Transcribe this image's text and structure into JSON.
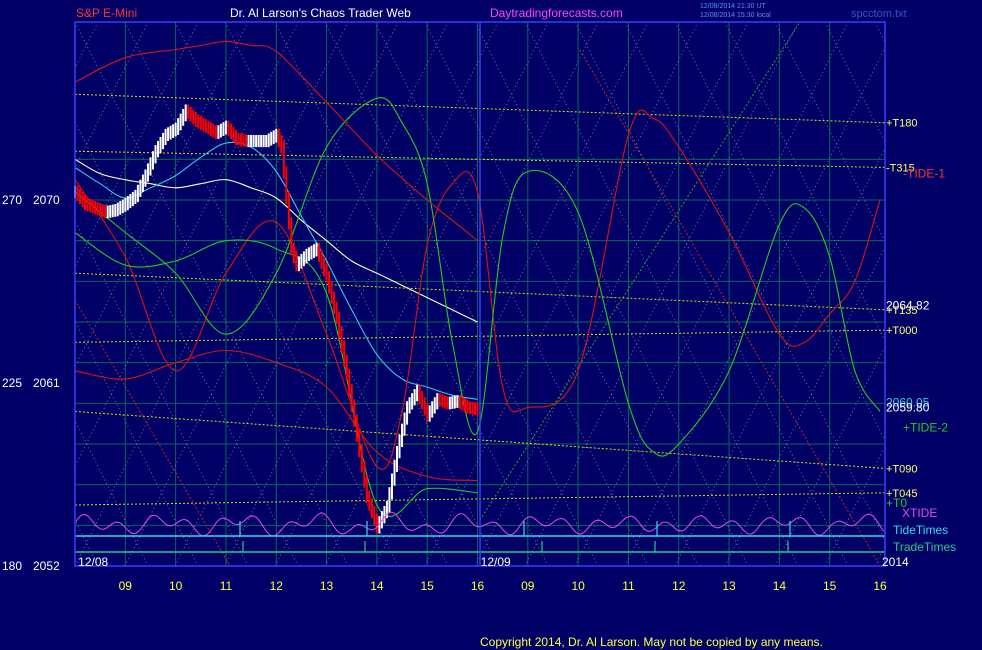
{
  "header": {
    "symbol": "S&P E-Mini",
    "site": "Dr. Al Larson's Chaos Trader Web",
    "url": "Daytradingforecasts.com",
    "stamp1": "12/08/2014 21:30 UT",
    "stamp2": "12/08/2014 15:30 local",
    "file": "spcctom.txt"
  },
  "footer": {
    "copyright": "Copyright 2014, Dr. Al Larson. May not be copied by any means."
  },
  "colors": {
    "background": "#000066",
    "plot_border": "#3a3aff",
    "grid": "#006a5a",
    "price_white": "#ffffff",
    "price_red": "#ff0000",
    "ma_white": "#ffffc8",
    "ma_cyan": "#33ccdd",
    "tide_red": "#dd1111",
    "tide_green": "#22cc22",
    "levels_yellow": "#dddd00",
    "xtide": "#ee44ee",
    "tidetimes": "#33ddee",
    "tradetimes": "#22cc88"
  },
  "chart_data": {
    "type": "line",
    "title": "S&P E-Mini",
    "ylim": [
      2052,
      2074
    ],
    "left_axis_labels": [
      {
        "angle": "270",
        "price": "2070",
        "value": 2070
      },
      {
        "angle": "225",
        "price": "2061",
        "value": 2061
      },
      {
        "angle": "180",
        "price": "2052",
        "value": 2052
      }
    ],
    "x_ticks": [
      {
        "label": "09",
        "t": 1
      },
      {
        "label": "10",
        "t": 2
      },
      {
        "label": "11",
        "t": 3
      },
      {
        "label": "12",
        "t": 4
      },
      {
        "label": "13",
        "t": 5
      },
      {
        "label": "14",
        "t": 6
      },
      {
        "label": "15",
        "t": 7
      },
      {
        "label": "16",
        "t": 8
      },
      {
        "label": "09",
        "t": 9
      },
      {
        "label": "10",
        "t": 10
      },
      {
        "label": "11",
        "t": 11
      },
      {
        "label": "12",
        "t": 12
      },
      {
        "label": "13",
        "t": 13
      },
      {
        "label": "14",
        "t": 14
      },
      {
        "label": "15",
        "t": 15
      },
      {
        "label": "16",
        "t": 16
      }
    ],
    "date_labels": [
      {
        "label": "12/08",
        "t": 0.5
      },
      {
        "label": "12/09",
        "t": 8.5
      },
      {
        "label": "2014",
        "t": 16
      }
    ],
    "day_divider_t": 8,
    "price": {
      "t": [
        0,
        0.2,
        0.4,
        0.6,
        0.8,
        1.0,
        1.2,
        1.4,
        1.6,
        1.8,
        2.0,
        2.2,
        2.4,
        2.6,
        2.8,
        3.0,
        3.2,
        3.4,
        3.6,
        3.8,
        4.0,
        4.1,
        4.2,
        4.3,
        4.4,
        4.6,
        4.8,
        5.0,
        5.2,
        5.4,
        5.6,
        5.8,
        6.0,
        6.2,
        6.4,
        6.6,
        6.8,
        7.0,
        7.2,
        7.4,
        7.6,
        7.8,
        8.0
      ],
      "close": [
        2070.4,
        2069.8,
        2069.6,
        2069.4,
        2069.5,
        2069.8,
        2070.2,
        2071.2,
        2072.4,
        2073.2,
        2073.5,
        2074.4,
        2073.9,
        2073.6,
        2073.3,
        2073.6,
        2073.0,
        2072.9,
        2072.9,
        2072.9,
        2073.2,
        2072.6,
        2070.1,
        2067.6,
        2066.8,
        2067.3,
        2067.6,
        2066.2,
        2064.2,
        2061.4,
        2058.4,
        2055.4,
        2053.9,
        2054.9,
        2057.6,
        2059.8,
        2060.6,
        2059.4,
        2060.2,
        2060.0,
        2060.1,
        2059.8,
        2059.7
      ],
      "upper_band": [
        2073.0,
        2072.6,
        2072.2,
        2071.8,
        2071.6,
        2071.7,
        2072.1,
        2073.0,
        2074.0,
        2074.8,
        2075.2,
        2075.6,
        2075.4,
        2075.2,
        2075.0,
        2075.2,
        2074.8,
        2074.6,
        2074.4,
        2074.3,
        2074.4,
        2073.9,
        2072.9,
        2070.9,
        2069.9,
        2068.8,
        2068.6,
        2067.6,
        2065.8,
        2063.4,
        2060.8,
        2058.2,
        2057.2,
        2058.4,
        2060.6,
        2062.2,
        2062.6,
        2061.8,
        2062.2,
        2062.0,
        2062.2,
        2062.0,
        2061.8
      ],
      "lower_band": [
        2067.8,
        2067.0,
        2066.8,
        2066.8,
        2067.0,
        2067.4,
        2068.2,
        2069.2,
        2070.4,
        2071.4,
        2071.8,
        2072.8,
        2072.4,
        2072.0,
        2071.6,
        2071.8,
        2071.2,
        2071.0,
        2071.0,
        2071.2,
        2071.4,
        2070.8,
        2068.2,
        2065.6,
        2064.4,
        2064.8,
        2064.8,
        2063.6,
        2061.8,
        2059.2,
        2056.2,
        2053.2,
        2052.6,
        2053.4,
        2055.2,
        2057.6,
        2058.4,
        2057.4,
        2058.2,
        2058.0,
        2058.2,
        2057.8,
        2057.6
      ]
    },
    "series": [
      {
        "name": "ma_slow_white",
        "t": [
          0,
          0.5,
          1.0,
          1.5,
          2.0,
          2.5,
          3.0,
          3.5,
          4.0,
          4.5,
          5.0,
          5.5,
          6.0,
          6.5,
          7.0,
          7.5,
          8.0
        ],
        "values": [
          2072.0,
          2071.3,
          2071.0,
          2070.8,
          2070.6,
          2070.8,
          2071.0,
          2070.6,
          2070.1,
          2069.0,
          2068.0,
          2067.0,
          2066.4,
          2065.8,
          2065.2,
          2064.6,
          2064.0
        ]
      },
      {
        "name": "ma_fast_cyan",
        "t": [
          0,
          0.5,
          1.0,
          1.5,
          2.0,
          2.5,
          3.0,
          3.5,
          4.0,
          4.5,
          5.0,
          5.5,
          6.0,
          6.5,
          7.0,
          7.5,
          8.0
        ],
        "values": [
          2071.6,
          2070.8,
          2070.1,
          2070.6,
          2071.2,
          2072.1,
          2072.8,
          2072.6,
          2071.4,
          2069.2,
          2067.0,
          2064.6,
          2062.4,
          2061.2,
          2060.8,
          2060.4,
          2060.2
        ]
      },
      {
        "name": "tide_1_red",
        "t": [
          0,
          1,
          2,
          3,
          4,
          5,
          6,
          6.5,
          7,
          7.5,
          8,
          8.5,
          9,
          10,
          11,
          11.5,
          12,
          13,
          14,
          14.5,
          15,
          15.5,
          16
        ],
        "values": [
          2071.0,
          2067.2,
          2061.6,
          2066.4,
          2068.9,
          2063.4,
          2056.9,
          2059.6,
          2067.8,
          2070.8,
          2070.4,
          2060.8,
          2059.8,
          2061.6,
          2073.2,
          2074.0,
          2072.6,
          2068.4,
          2063.4,
          2063.0,
          2064.4,
          2066.0,
          2070.0
        ]
      },
      {
        "name": "tide_2_green",
        "t": [
          0,
          1,
          2,
          3,
          4,
          5,
          6,
          6.5,
          7,
          7.5,
          8,
          8.5,
          9,
          10,
          11,
          11.5,
          12,
          13,
          14,
          14.5,
          15,
          15.5,
          16
        ],
        "values": [
          2070.4,
          2068.4,
          2066.4,
          2063.4,
          2066.4,
          2072.6,
          2075.0,
          2073.8,
          2070.8,
          2063.0,
          2058.6,
          2068.2,
          2071.4,
          2069.4,
          2060.0,
          2057.6,
          2058.0,
          2061.6,
          2068.8,
          2069.6,
          2067.2,
          2061.6,
          2059.6
        ]
      },
      {
        "name": "band_red_upper",
        "t": [
          0,
          1,
          2,
          2.5,
          3,
          3.5,
          4,
          5,
          6,
          7,
          7.5,
          8
        ],
        "values": [
          2075.8,
          2077.0,
          2077.4,
          2077.6,
          2077.8,
          2077.6,
          2077.3,
          2074.8,
          2072.2,
          2070.0,
          2069.0,
          2068.0
        ]
      },
      {
        "name": "band_red_lower",
        "t": [
          0,
          1,
          2,
          3,
          4,
          5,
          6,
          7,
          8
        ],
        "values": [
          2061.6,
          2061.2,
          2062.0,
          2062.6,
          2062.0,
          2060.8,
          2057.6,
          2056.4,
          2056.2
        ]
      },
      {
        "name": "band_green_lower",
        "t": [
          0,
          1,
          2,
          3,
          4,
          5,
          6,
          7,
          8
        ],
        "values": [
          2068.4,
          2066.8,
          2067.0,
          2068.0,
          2067.6,
          2065.4,
          2055.0,
          2055.8,
          2055.6
        ]
      }
    ],
    "levels": [
      {
        "label": "+T180",
        "y0": 2075.2,
        "y1": 2073.8,
        "color": "#dddd00"
      },
      {
        "label": "-T315",
        "y0": 2072.4,
        "y1": 2071.6,
        "color": "#dddd00"
      },
      {
        "label": "+T135",
        "y0": 2066.4,
        "y1": 2064.6,
        "color": "#dddd00"
      },
      {
        "label": "+T000",
        "y0": 2063.0,
        "y1": 2063.6,
        "color": "#dddd00"
      },
      {
        "label": "+T090",
        "y0": 2059.6,
        "y1": 2056.8,
        "color": "#dddd00"
      },
      {
        "label": "+T045",
        "y0": 2055.0,
        "y1": 2055.6,
        "color": "#dddd00"
      }
    ],
    "right_labels": [
      {
        "text": "-TIDE-1",
        "value": 2071.3,
        "color": "#ff3333"
      },
      {
        "text": "2064.82",
        "value": 2064.82,
        "color": "#ffffff"
      },
      {
        "text": "2060.05",
        "value": 2060.05,
        "color": "#33ccdd"
      },
      {
        "text": "2059.80",
        "value": 2059.8,
        "color": "#ffffff"
      },
      {
        "text": "+TIDE-2",
        "value": 2058.8,
        "color": "#22cc22"
      },
      {
        "text": "+T0",
        "value": 2055.1,
        "color": "#22cc22"
      }
    ],
    "indicators": [
      {
        "text": "XTIDE",
        "color": "#ee44ee"
      },
      {
        "text": "TideTimes",
        "color": "#33ddee"
      },
      {
        "text": "TradeTimes",
        "color": "#22cc88"
      }
    ]
  }
}
